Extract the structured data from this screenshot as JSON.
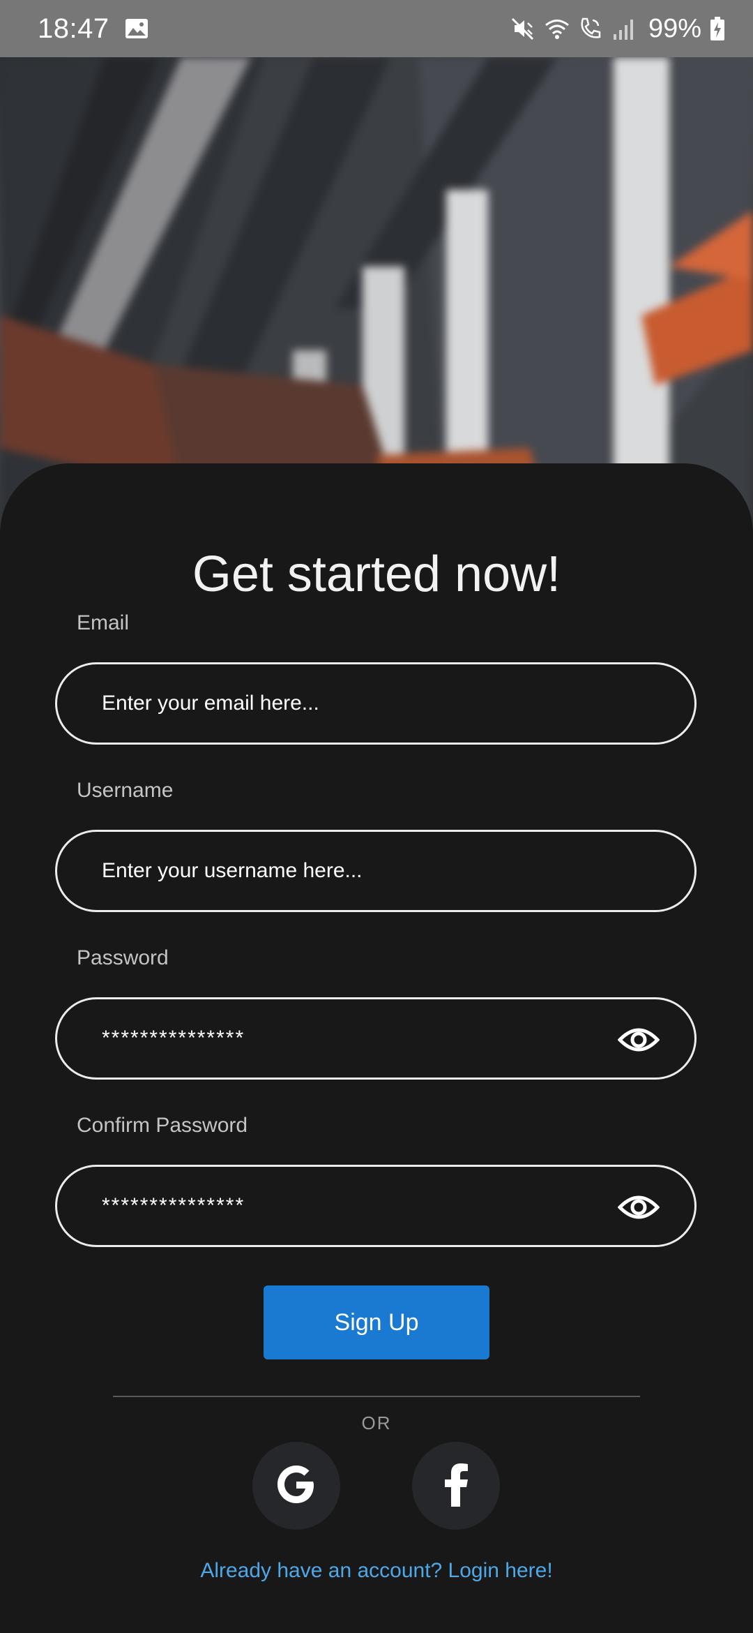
{
  "status_bar": {
    "time": "18:47",
    "battery": "99%",
    "icons": [
      "gallery-icon",
      "mute-icon",
      "wifi-icon",
      "wifi-calling-icon",
      "signal-icon",
      "battery-charging-icon"
    ]
  },
  "hero": {
    "icon": "hero-image"
  },
  "form": {
    "title": "Get started now!",
    "email": {
      "label": "Email",
      "placeholder": "Enter your email here..."
    },
    "username": {
      "label": "Username",
      "placeholder": "Enter your username here..."
    },
    "password": {
      "label": "Password",
      "value": "***************",
      "toggle_icon": "eye-icon"
    },
    "confirm_password": {
      "label": "Confirm Password",
      "value": "***************",
      "toggle_icon": "eye-icon"
    },
    "submit_label": "Sign Up"
  },
  "divider": {
    "text": "OR"
  },
  "social": {
    "google_icon": "google-icon",
    "facebook_icon": "facebook-icon"
  },
  "footer": {
    "login_link": "Already have an account? Login here!"
  },
  "colors": {
    "background": "#181818",
    "accent": "#1a7ad2",
    "link": "#4ea8e8",
    "field_border": "#ececec",
    "social_bg": "#26272a"
  }
}
